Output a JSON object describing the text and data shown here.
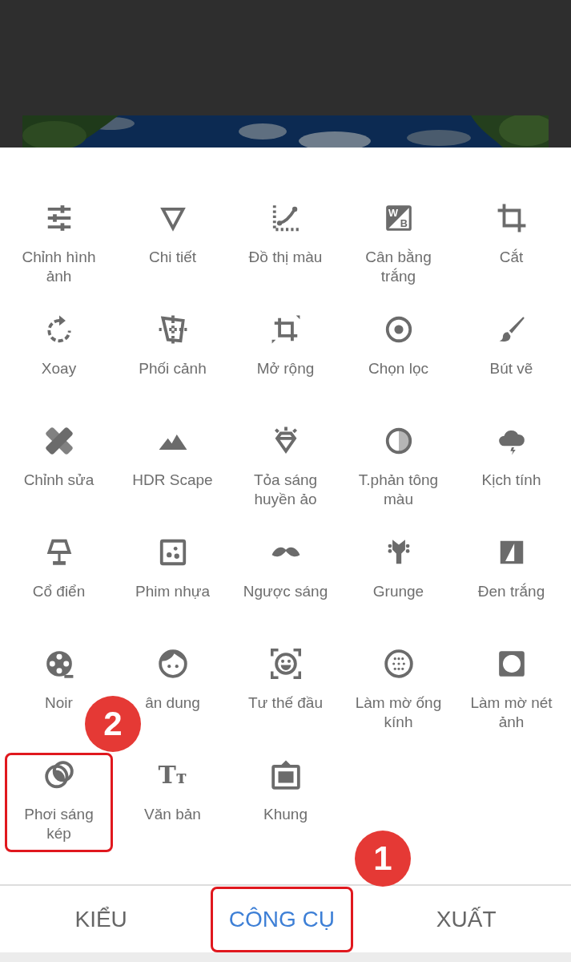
{
  "tools": [
    {
      "label": "Chỉnh hình ảnh",
      "highlighted": false
    },
    {
      "label": "Chi tiết",
      "highlighted": false
    },
    {
      "label": "Đồ thị màu",
      "highlighted": false
    },
    {
      "label": "Cân bằng trắng",
      "highlighted": false,
      "icon_letters": [
        "W",
        "B"
      ]
    },
    {
      "label": "Cắt",
      "highlighted": false
    },
    {
      "label": "Xoay",
      "highlighted": false
    },
    {
      "label": "Phối cảnh",
      "highlighted": false
    },
    {
      "label": "Mở rộng",
      "highlighted": false
    },
    {
      "label": "Chọn lọc",
      "highlighted": false
    },
    {
      "label": "Bút vẽ",
      "highlighted": false
    },
    {
      "label": "Chỉnh sửa",
      "highlighted": false
    },
    {
      "label": "HDR Scape",
      "highlighted": false
    },
    {
      "label": "Tỏa sáng huyền ảo",
      "highlighted": false
    },
    {
      "label": "T.phản tông màu",
      "highlighted": false
    },
    {
      "label": "Kịch tính",
      "highlighted": false
    },
    {
      "label": "Cổ điển",
      "highlighted": false
    },
    {
      "label": "Phim nhựa",
      "highlighted": false
    },
    {
      "label": "Ngược sáng",
      "highlighted": false
    },
    {
      "label": "Grunge",
      "highlighted": false
    },
    {
      "label": "Đen trắng",
      "highlighted": false
    },
    {
      "label": "Noir",
      "highlighted": false
    },
    {
      "label": "ân dung",
      "highlighted": false
    },
    {
      "label": "Tư thế đầu",
      "highlighted": false
    },
    {
      "label": "Làm mờ ống kính",
      "highlighted": false
    },
    {
      "label": "Làm mờ nét ảnh",
      "highlighted": false
    },
    {
      "label": "Phơi sáng kép",
      "highlighted": true
    },
    {
      "label": "Văn bản",
      "highlighted": false,
      "icon_letters": [
        "T",
        "т"
      ]
    },
    {
      "label": "Khung",
      "highlighted": false
    }
  ],
  "tabs": [
    {
      "label": "KIỂU",
      "selected": false,
      "highlighted": false
    },
    {
      "label": "CÔNG CỤ",
      "selected": true,
      "highlighted": true
    },
    {
      "label": "XUẤT",
      "selected": false,
      "highlighted": false
    }
  ],
  "annotations": [
    {
      "label": "2"
    },
    {
      "label": "1"
    }
  ]
}
